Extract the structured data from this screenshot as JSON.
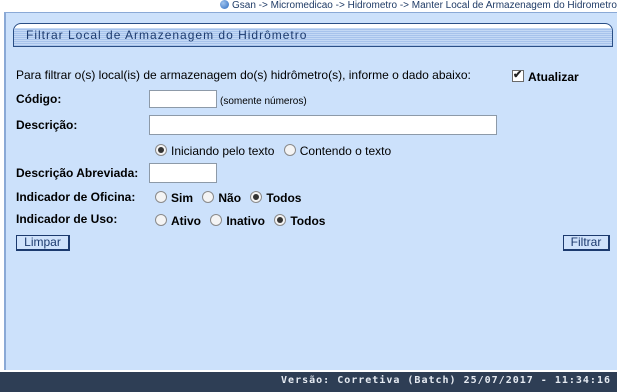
{
  "breadcrumb": "Gsan -> Micromedicao -> Hidrometro -> Manter Local de Armazenagem do Hidrometro",
  "title": "Filtrar Local de Armazenagem do Hidrômetro",
  "instructions": "Para filtrar o(s) local(is) de armazenagem do(s) hidrômetro(s), informe o dado abaixo:",
  "atualizar": {
    "label": "Atualizar",
    "checked": true
  },
  "codigo": {
    "label": "Código:",
    "value": "",
    "hint": "(somente números)"
  },
  "descricao": {
    "label": "Descrição:",
    "value": "",
    "options": [
      {
        "label": "Iniciando pelo texto",
        "selected": true
      },
      {
        "label": "Contendo o texto",
        "selected": false
      }
    ]
  },
  "descricao_abreviada": {
    "label": "Descrição Abreviada:",
    "value": ""
  },
  "indicador_oficina": {
    "label": "Indicador de Oficina:",
    "options": [
      {
        "label": "Sim",
        "selected": false
      },
      {
        "label": "Não",
        "selected": false
      },
      {
        "label": "Todos",
        "selected": true
      }
    ]
  },
  "indicador_uso": {
    "label": "Indicador de Uso:",
    "options": [
      {
        "label": "Ativo",
        "selected": false
      },
      {
        "label": "Inativo",
        "selected": false
      },
      {
        "label": "Todos",
        "selected": true
      }
    ]
  },
  "buttons": {
    "limpar": "Limpar",
    "filtrar": "Filtrar"
  },
  "footer": "Versão: Corretiva (Batch) 25/07/2017 - 11:34:16"
}
